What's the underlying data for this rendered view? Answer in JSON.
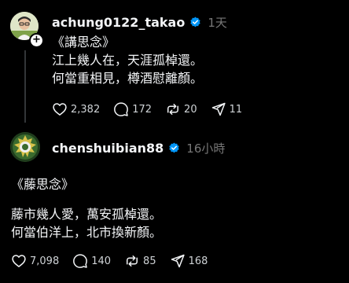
{
  "posts": [
    {
      "username": "achung0122_takao",
      "timestamp": "1天",
      "verified": true,
      "avatar": "avatar-photo",
      "lines": [
        "《講思念》",
        "江上幾人在，天涯孤棹還。",
        "何當重相見，樽酒慰離顏。"
      ],
      "actions": {
        "likes": "2,382",
        "comments": "172",
        "reposts": "20",
        "shares": "11"
      }
    },
    {
      "username": "chenshuibian88",
      "timestamp": "16小時",
      "verified": true,
      "avatar": "avatar-emblem",
      "lines": [
        "《藤思念》",
        "藤市幾人愛，萬安孤棹還。",
        "何當伯洋上，北市換新顏。"
      ],
      "actions": {
        "likes": "7,098",
        "comments": "140",
        "reposts": "85",
        "shares": "168"
      }
    }
  ],
  "icons": {
    "verified": "verified-check-icon",
    "like": "heart-icon",
    "comment": "comment-bubble-icon",
    "repost": "repost-arrows-icon",
    "share": "send-arrow-icon",
    "follow": "plus-icon"
  },
  "colors": {
    "background": "#000000",
    "text": "#f3f5f7",
    "muted": "#777777",
    "verified": "#0095f6"
  }
}
